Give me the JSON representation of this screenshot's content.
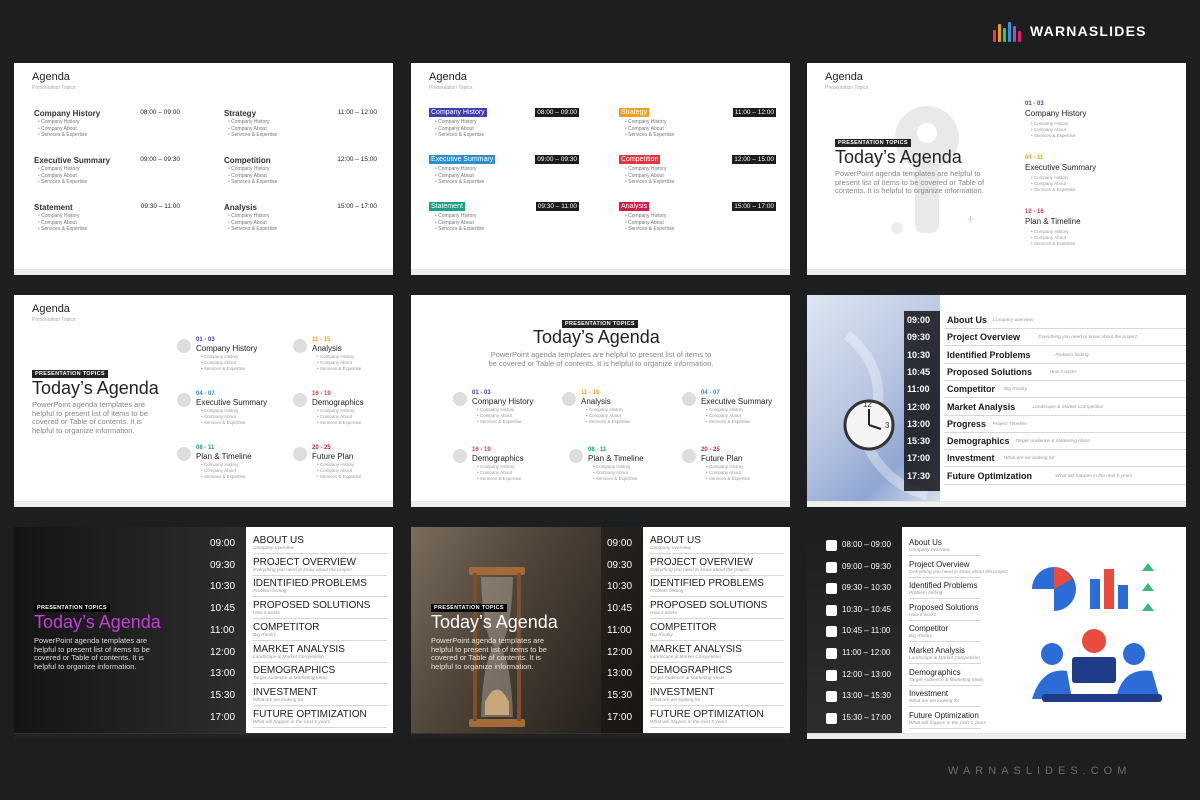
{
  "brand": {
    "name": "WARNASLIDES",
    "footer": "WARNASLIDES.COM",
    "logo_colors": [
      "#e4423f",
      "#f39c12",
      "#2ecc71",
      "#3498db",
      "#9b59b6",
      "#e91e63"
    ]
  },
  "colors": {
    "background": "#1d1e20",
    "purple": "#3f3fb0",
    "orange": "#f2a01e",
    "blue": "#2c8fc9",
    "red": "#e0383e",
    "teal": "#17a188",
    "crimson": "#d11f4a"
  },
  "common": {
    "agenda_title": "Agenda",
    "agenda_subtitle": "Presentation Topics",
    "hero_label": "PRESENTATION TOPICS",
    "hero_title": "Today’s Agenda",
    "hero_desc": "PowerPoint agenda templates are helpful to present list of items to be covered or Table of contents. It is helpful to organize information.",
    "bullets": [
      "Company History",
      "Company About",
      "Services & Expertise"
    ]
  },
  "slide1": {
    "groups": [
      {
        "name": "Company History",
        "time": "08:00 – 09:00"
      },
      {
        "name": "Strategy",
        "time": "11:00 – 12:00"
      },
      {
        "name": "Executive Summary",
        "time": "09:00 – 09:30"
      },
      {
        "name": "Competition",
        "time": "12:00 – 15:00"
      },
      {
        "name": "Statement",
        "time": "09:30 – 11:00"
      },
      {
        "name": "Analysis",
        "time": "15:00 – 17:00"
      }
    ]
  },
  "slide3": {
    "items": [
      {
        "num": "01 - 03",
        "name": "Company History"
      },
      {
        "num": "04 - 11",
        "name": "Executive Summary"
      },
      {
        "num": "12 - 16",
        "name": "Plan & Timeline"
      }
    ]
  },
  "slide45": {
    "items": [
      {
        "num": "01 - 03",
        "name": "Company History"
      },
      {
        "num": "11 - 15",
        "name": "Analysis"
      },
      {
        "num": "04 - 07",
        "name": "Executive Summary"
      },
      {
        "num": "16 - 19",
        "name": "Demographics"
      },
      {
        "num": "08 - 11",
        "name": "Plan & Timeline"
      },
      {
        "num": "20 - 25",
        "name": "Future Plan"
      }
    ]
  },
  "slide6": {
    "rows": [
      {
        "time": "09:00",
        "name": "About Us",
        "sub": "Company overview"
      },
      {
        "time": "09:30",
        "name": "Project Overview",
        "sub": "Everything you need to know about the project"
      },
      {
        "time": "10:30",
        "name": "Identified Problems",
        "sub": "Problem finding"
      },
      {
        "time": "10:45",
        "name": "Proposed Solutions",
        "sub": "How it works"
      },
      {
        "time": "11:00",
        "name": "Competitor",
        "sub": "Big Rivalry"
      },
      {
        "time": "12:00",
        "name": "Market Analysis",
        "sub": "Landscape & Market Competition"
      },
      {
        "time": "13:00",
        "name": "Progress",
        "sub": "Project Timeline"
      },
      {
        "time": "15:30",
        "name": "Demographics",
        "sub": "Target Audience & Marketing Ideas"
      },
      {
        "time": "17:00",
        "name": "Investment",
        "sub": "What are we looking for"
      },
      {
        "time": "17:30",
        "name": "Future Optimization",
        "sub": "What will happen in the next 5 years"
      }
    ]
  },
  "slide78": {
    "rows": [
      {
        "time": "09:00",
        "name": "ABOUT US",
        "sub": "Company overview"
      },
      {
        "time": "09:30",
        "name": "PROJECT OVERVIEW",
        "sub": "Everything you need to know about the project"
      },
      {
        "time": "10:30",
        "name": "IDENTIFIED PROBLEMS",
        "sub": "Problem finding"
      },
      {
        "time": "10:45",
        "name": "PROPOSED SOLUTIONS",
        "sub": "How it works"
      },
      {
        "time": "11:00",
        "name": "COMPETITOR",
        "sub": "Big Rivalry"
      },
      {
        "time": "12:00",
        "name": "MARKET ANALYSIS",
        "sub": "Landscape & Market Competition"
      },
      {
        "time": "13:00",
        "name": "DEMOGRAPHICS",
        "sub": "Target Audience & Marketing Ideas"
      },
      {
        "time": "15:30",
        "name": "INVESTMENT",
        "sub": "What are we looking for"
      },
      {
        "time": "17:00",
        "name": "FUTURE OPTIMIZATION",
        "sub": "What will happen in the next 5 years"
      }
    ]
  },
  "slide9": {
    "rows": [
      {
        "time": "08:00 – 09:00",
        "name": "About Us",
        "sub": "Company overview"
      },
      {
        "time": "09:00 – 09:30",
        "name": "Project Overview",
        "sub": "Everything you need to know about the project"
      },
      {
        "time": "09:30 – 10:30",
        "name": "Identified Problems",
        "sub": "Problem finding"
      },
      {
        "time": "10:30 – 10:45",
        "name": "Proposed Solutions",
        "sub": "How it works"
      },
      {
        "time": "10:45 – 11:00",
        "name": "Competitor",
        "sub": "Big Rivalry"
      },
      {
        "time": "11:00 – 12:00",
        "name": "Market Analysis",
        "sub": "Landscape & Market Competition"
      },
      {
        "time": "12:00 – 13:00",
        "name": "Demographics",
        "sub": "Target Audience & Marketing Ideas"
      },
      {
        "time": "13:00 – 15:30",
        "name": "Investment",
        "sub": "What are we looking for"
      },
      {
        "time": "15:30 – 17:00",
        "name": "Future Optimization",
        "sub": "What will happen in the next 5 years"
      }
    ]
  }
}
